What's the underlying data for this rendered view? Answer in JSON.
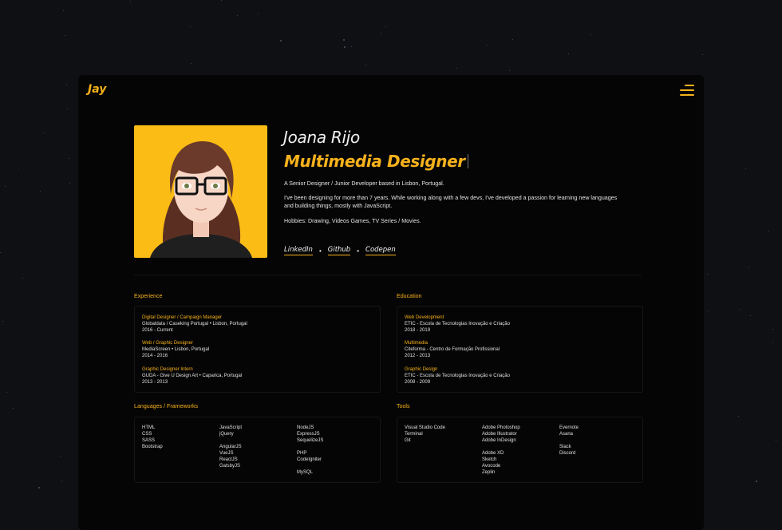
{
  "brand": {
    "logo": "Jay"
  },
  "profile": {
    "name": "Joana Rijo",
    "title": "Multimedia Designer",
    "bio": [
      "A Senior Designer / Junior Developer based in Lisbon, Portugal.",
      "I've been designing for more than 7 years. While working along with a few devs, I've developed a passion for learning new languages and building things, mostly with JavaScript.",
      "Hobbies: Drawing, Videos Games, TV Series / Movies."
    ],
    "links": [
      "LinkedIn",
      "Github",
      "Codepen"
    ],
    "link_separator": "•"
  },
  "experience": {
    "heading": "Experience",
    "items": [
      {
        "role": "Digital Designer / Campaign Manager",
        "place": "Globaldata / Caseking Portugal • Lisbon, Portugal",
        "period": "2016 - Current"
      },
      {
        "role": "Web / Graphic Designer",
        "place": "MediaScreen • Lisbon, Portugal",
        "period": "2014 - 2016"
      },
      {
        "role": "Graphic Designer Intern",
        "place": "GUDA - Give U Design Art • Caparica, Portugal",
        "period": "2013 - 2013"
      }
    ]
  },
  "education": {
    "heading": "Education",
    "items": [
      {
        "course": "Web Development",
        "school": "ETIC - Escola de Tecnologias Inovação e Criação",
        "period": "2018 - 2019"
      },
      {
        "course": "Multimedia",
        "school": "Citeforma - Centro de Formação Profissional",
        "period": "2012 - 2013"
      },
      {
        "course": "Graphic Design",
        "school": "ETIC - Escola de Tecnologias Inovação e Criação",
        "period": "2008 - 2009"
      }
    ]
  },
  "languages": {
    "heading": "Languages / Frameworks",
    "columns": [
      [
        "HTML",
        "CSS",
        "SASS",
        "Bootstrap"
      ],
      [
        "JavaScript",
        "jQuery",
        "",
        "AngularJS",
        "VueJS",
        "ReactJS",
        "GatsbyJS"
      ],
      [
        "NodeJS",
        "ExpressJS",
        "SequelizeJS",
        "",
        "PHP",
        "CodeIgniter",
        "",
        "MySQL"
      ]
    ]
  },
  "tools": {
    "heading": "Tools",
    "columns": [
      [
        "Visual Studio Code",
        "Terminal",
        "Git"
      ],
      [
        "Adobe Photoshop",
        "Adobe Illustrator",
        "Adobe InDesign",
        "",
        "Adobe XD",
        "Sketch",
        "Avocode",
        "Zeplin"
      ],
      [
        "Evernote",
        "Asana",
        "",
        "Slack",
        "Discord"
      ]
    ]
  },
  "colors": {
    "accent": "#f7b21c",
    "background": "#0e1013",
    "card": "#050505",
    "avatar_bg": "#fbbc16"
  },
  "icons": {
    "menu": "hamburger-menu-icon"
  }
}
